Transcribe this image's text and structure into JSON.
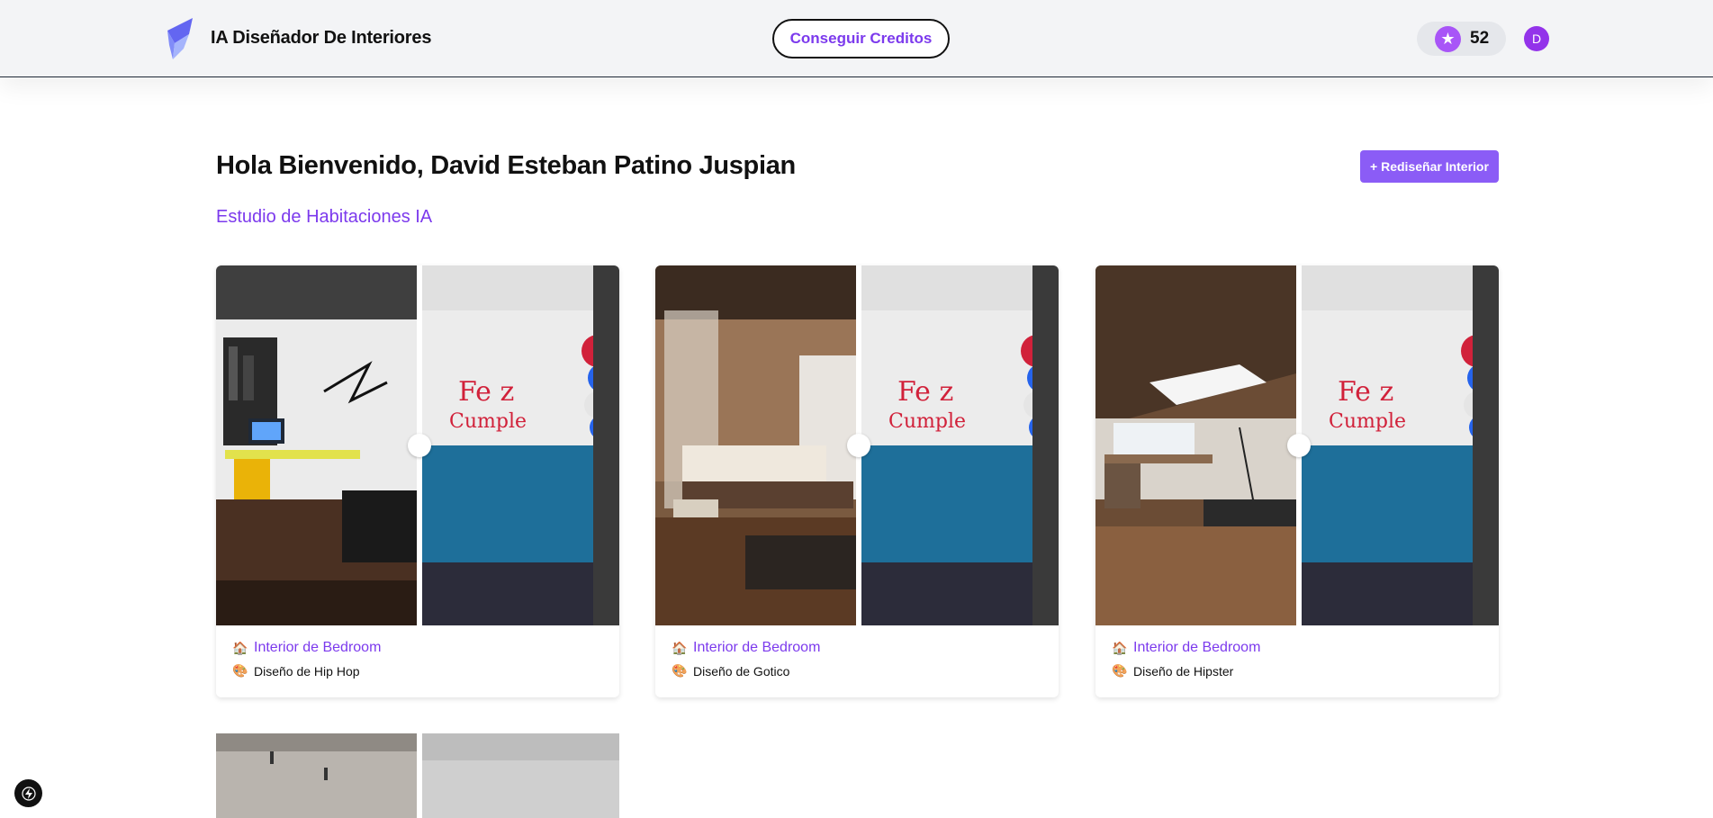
{
  "header": {
    "brand": "IA Diseñador De Interiores",
    "credits_button": "Conseguir Creditos",
    "credit_count": "52",
    "avatar_initial": "D"
  },
  "main": {
    "greeting": "Hola Bienvenido, David Esteban Patino Juspian",
    "subtitle": "Estudio de Habitaciones IA",
    "redesign_button": "+ Rediseñar Interior"
  },
  "cards": [
    {
      "room": "Interior de Bedroom",
      "style": "Diseño de Hip Hop",
      "room_icon": "house-icon",
      "style_icon": "palette-icon"
    },
    {
      "room": "Interior de Bedroom",
      "style": "Diseño de Gotico",
      "room_icon": "house-icon",
      "style_icon": "palette-icon"
    },
    {
      "room": "Interior de Bedroom",
      "style": "Diseño de Hipster",
      "room_icon": "house-icon",
      "style_icon": "palette-icon"
    }
  ],
  "colors": {
    "accent": "#7c3aed",
    "button": "#8b5cf6",
    "avatar": "#9333ea",
    "header_bg": "#f3f4f6"
  }
}
